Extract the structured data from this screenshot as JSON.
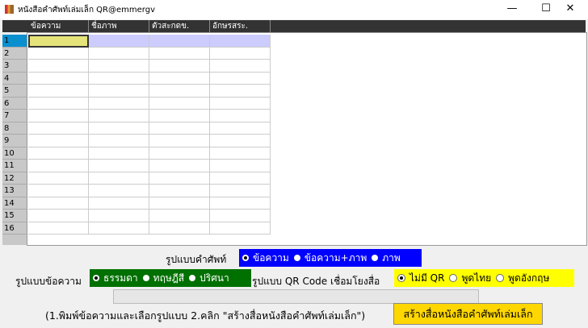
{
  "window": {
    "title": "หนังสือคำศัพท์เล่มเล็ก QR@emmergv",
    "minimize": "—",
    "maximize": "☐",
    "close": "✕"
  },
  "grid": {
    "columns": [
      "ข้อความ",
      "ชื่อภาพ",
      "ตัวสะกดข.",
      "อักษรสระ."
    ],
    "rows": [
      "1",
      "2",
      "3",
      "4",
      "5",
      "6",
      "7",
      "8",
      "9",
      "10",
      "11",
      "12",
      "13",
      "14",
      "15",
      "16"
    ]
  },
  "vocab_format": {
    "label": "รูปแบบคำศัพท์",
    "options": [
      "ข้อความ",
      "ข้อความ+ภาพ",
      "ภาพ"
    ],
    "selected": 0,
    "color": "#0000ff"
  },
  "text_format": {
    "label": "รูปแบบข้อความ",
    "options": [
      "ธรรมดา",
      "ทฤษฎีสี",
      "ปริศนา"
    ],
    "selected": 0,
    "color": "#007000"
  },
  "qr_format": {
    "label": "รูปแบบ QR Code เชื่อมโยงสื่อ",
    "options": [
      "ไม่มี QR",
      "พูดไทย",
      "พูดอังกฤษ"
    ],
    "selected": 0,
    "color": "#ffff00"
  },
  "progress": 0,
  "instruction": "(1.พิมพ์ข้อความและเลือกรูปแบบ 2.คลิก \"สร้างสื่อหนังสือคำศัพท์เล่มเล็ก\")",
  "create_button": "สร้างสื่อหนังสือคำศัพท์เล่มเล็ก"
}
